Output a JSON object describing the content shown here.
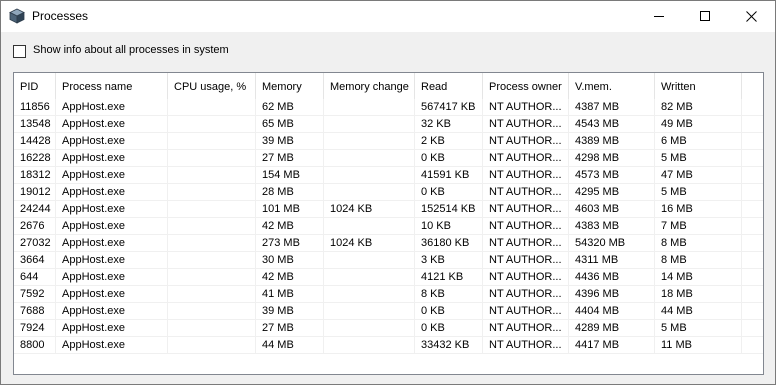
{
  "window": {
    "title": "Processes",
    "icon": "cube-icon",
    "controls": {
      "minimize": "minimize-icon",
      "maximize": "maximize-icon",
      "close": "close-icon"
    }
  },
  "options": {
    "show_all_label": "Show info about all processes in system",
    "show_all_checked": false
  },
  "table": {
    "columns": [
      "PID",
      "Process name",
      "CPU usage, %",
      "Memory",
      "Memory change",
      "Read",
      "Process owner",
      "V.mem.",
      "Written"
    ],
    "rows": [
      [
        "11856",
        "AppHost.exe",
        "",
        "62 MB",
        "",
        "567417 KB",
        "NT AUTHOR...",
        "4387 MB",
        "82 MB"
      ],
      [
        "13548",
        "AppHost.exe",
        "",
        "65 MB",
        "",
        "32 KB",
        "NT AUTHOR...",
        "4543 MB",
        "49 MB"
      ],
      [
        "14428",
        "AppHost.exe",
        "",
        "39 MB",
        "",
        "2 KB",
        "NT AUTHOR...",
        "4389 MB",
        "6 MB"
      ],
      [
        "16228",
        "AppHost.exe",
        "",
        "27 MB",
        "",
        "0 KB",
        "NT AUTHOR...",
        "4298 MB",
        "5 MB"
      ],
      [
        "18312",
        "AppHost.exe",
        "",
        "154 MB",
        "",
        "41591 KB",
        "NT AUTHOR...",
        "4573 MB",
        "47 MB"
      ],
      [
        "19012",
        "AppHost.exe",
        "",
        "28 MB",
        "",
        "0 KB",
        "NT AUTHOR...",
        "4295 MB",
        "5 MB"
      ],
      [
        "24244",
        "AppHost.exe",
        "",
        "101 MB",
        "1024 KB",
        "152514 KB",
        "NT AUTHOR...",
        "4603 MB",
        "16 MB"
      ],
      [
        "2676",
        "AppHost.exe",
        "",
        "42 MB",
        "",
        "10 KB",
        "NT AUTHOR...",
        "4383 MB",
        "7 MB"
      ],
      [
        "27032",
        "AppHost.exe",
        "",
        "273 MB",
        "1024 KB",
        "36180 KB",
        "NT AUTHOR...",
        "54320 MB",
        "8 MB"
      ],
      [
        "3664",
        "AppHost.exe",
        "",
        "30 MB",
        "",
        "3 KB",
        "NT AUTHOR...",
        "4311 MB",
        "8 MB"
      ],
      [
        "644",
        "AppHost.exe",
        "",
        "42 MB",
        "",
        "4121 KB",
        "NT AUTHOR...",
        "4436 MB",
        "14 MB"
      ],
      [
        "7592",
        "AppHost.exe",
        "",
        "41 MB",
        "",
        "8 KB",
        "NT AUTHOR...",
        "4396 MB",
        "18 MB"
      ],
      [
        "7688",
        "AppHost.exe",
        "",
        "39 MB",
        "",
        "0 KB",
        "NT AUTHOR...",
        "4404 MB",
        "44 MB"
      ],
      [
        "7924",
        "AppHost.exe",
        "",
        "27 MB",
        "",
        "0 KB",
        "NT AUTHOR...",
        "4289 MB",
        "5 MB"
      ],
      [
        "8800",
        "AppHost.exe",
        "",
        "44 MB",
        "",
        "33432 KB",
        "NT AUTHOR...",
        "4417 MB",
        "11 MB"
      ]
    ]
  }
}
